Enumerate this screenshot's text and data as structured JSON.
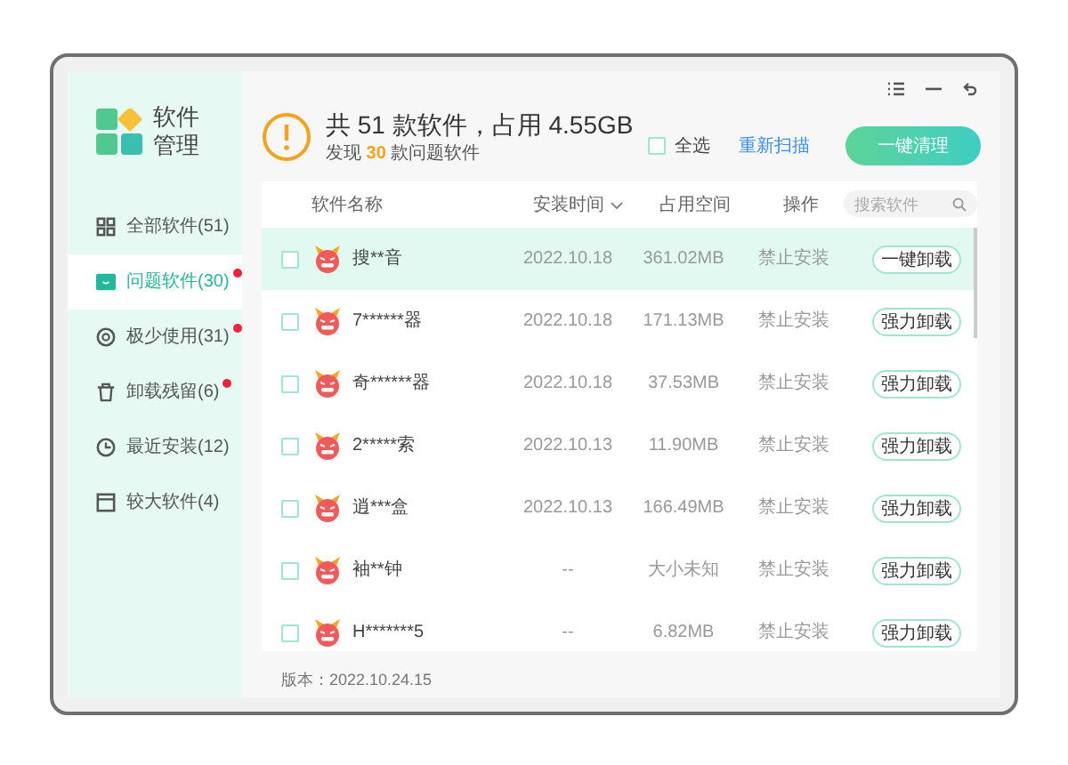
{
  "app": {
    "name_line1": "软件",
    "name_line2": "管理"
  },
  "sidebar": {
    "items": [
      {
        "label": "全部软件(51)",
        "kind": "grid",
        "selected": false,
        "alert": false
      },
      {
        "label": "问题软件(30)",
        "kind": "warning",
        "selected": true,
        "alert": true
      },
      {
        "label": "极少使用(31)",
        "kind": "aperture",
        "selected": false,
        "alert": true
      },
      {
        "label": "卸载残留(6)",
        "kind": "trash",
        "selected": false,
        "alert": true
      },
      {
        "label": "最近安装(12)",
        "kind": "clock",
        "selected": false,
        "alert": false
      },
      {
        "label": "较大软件(4)",
        "kind": "window",
        "selected": false,
        "alert": false
      }
    ]
  },
  "header": {
    "title": "共 51 款软件，占用 4.55GB",
    "subtitle_before": "发现",
    "subtitle_count": "30",
    "subtitle_after": "款问题软件",
    "select_all": {
      "label": "全选",
      "checked": false
    },
    "rescan": "重新扫描",
    "clean": "一键清理"
  },
  "table": {
    "columns": [
      "软件名称",
      "安装时间",
      "占用空间",
      "操作"
    ],
    "search": {
      "placeholder": "搜索软件"
    },
    "rows": [
      {
        "name": "搜**音",
        "date": "2022.10.18",
        "size": "361.02MB",
        "status": "禁止安装",
        "action": "一键卸载",
        "selected": true,
        "checked": false
      },
      {
        "name": "7******器",
        "date": "2022.10.18",
        "size": "171.13MB",
        "status": "禁止安装",
        "action": "强力卸载",
        "selected": false,
        "checked": false
      },
      {
        "name": "奇******器",
        "date": "2022.10.18",
        "size": "37.53MB",
        "status": "禁止安装",
        "action": "强力卸载",
        "selected": false,
        "checked": false
      },
      {
        "name": "2*****索",
        "date": "2022.10.13",
        "size": "11.90MB",
        "status": "禁止安装",
        "action": "强力卸载",
        "selected": false,
        "checked": false
      },
      {
        "name": "逍***盒",
        "date": "2022.10.13",
        "size": "166.49MB",
        "status": "禁止安装",
        "action": "强力卸载",
        "selected": false,
        "checked": false
      },
      {
        "name": "袖**钟",
        "date": "--",
        "size": "大小未知",
        "status": "禁止安装",
        "action": "强力卸载",
        "selected": false,
        "checked": false
      },
      {
        "name": "H*******5",
        "date": "--",
        "size": "6.82MB",
        "status": "禁止安装",
        "action": "强力卸载",
        "selected": false,
        "checked": false
      }
    ]
  },
  "footer": {
    "version": "版本：2022.10.24.15"
  }
}
